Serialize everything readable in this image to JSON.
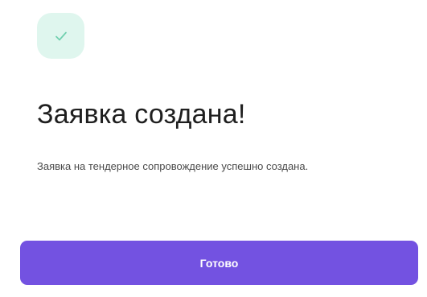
{
  "success_dialog": {
    "icon": "check-icon",
    "accent_color": "#7352e1",
    "icon_color": "#6fcfae",
    "icon_background": "#dff6ee",
    "title": "Заявка создана!",
    "description": "Заявка на тендерное сопровождение успешно создана.",
    "done_button_label": "Готово"
  }
}
